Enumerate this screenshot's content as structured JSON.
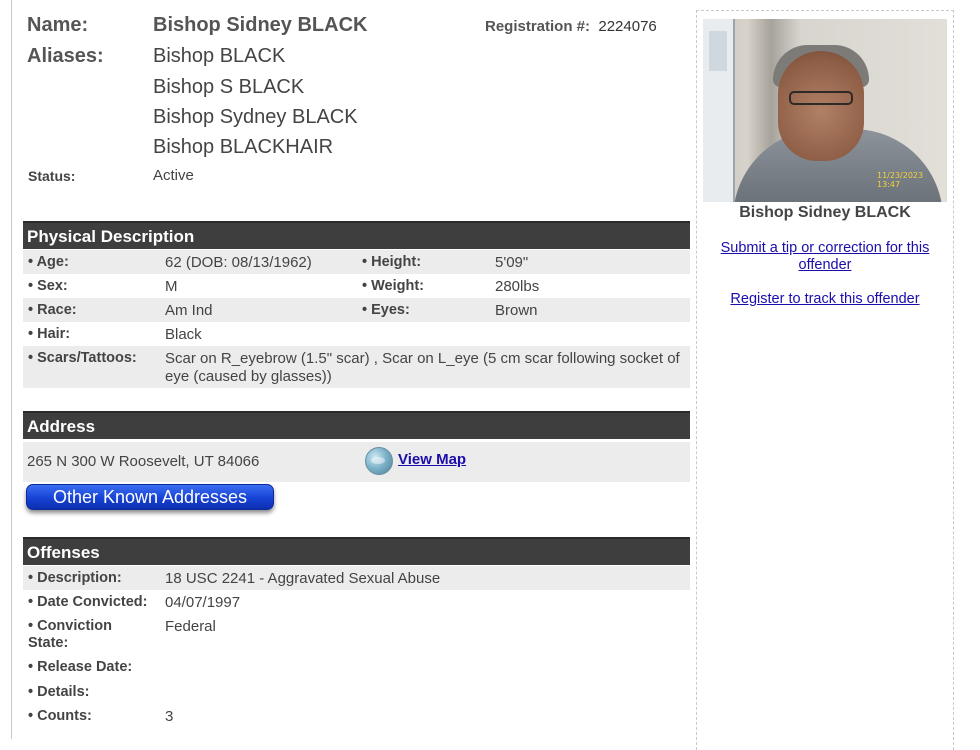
{
  "header": {
    "name_label": "Name:",
    "name_value": "Bishop Sidney BLACK",
    "aliases_label": "Aliases:",
    "aliases": [
      "Bishop BLACK",
      "Bishop S BLACK",
      "Bishop Sydney BLACK",
      "Bishop BLACKHAIR"
    ],
    "registration_label": "Registration #:",
    "registration_value": "2224076",
    "status_label": "Status:",
    "status_value": "Active"
  },
  "physical": {
    "title": "Physical Description",
    "age_label": "• Age:",
    "age_value": "62  (DOB: 08/13/1962)",
    "height_label": "• Height:",
    "height_value": "5'09\"",
    "sex_label": "• Sex:",
    "sex_value": "M",
    "weight_label": "• Weight:",
    "weight_value": "280lbs",
    "race_label": "• Race:",
    "race_value": "Am Ind",
    "eyes_label": "• Eyes:",
    "eyes_value": "Brown",
    "hair_label": "• Hair:",
    "hair_value": "Black",
    "scars_label": "• Scars/Tattoos:",
    "scars_line1": "Scar on R_eyebrow (1.5\" scar) , Scar on L_eye (5 cm scar following socket of",
    "scars_line2": "eye (caused by glasses))"
  },
  "address": {
    "title": "Address",
    "text": "265 N 300 W Roosevelt, UT 84066",
    "map_link": "View Map",
    "map_icon": "globe-icon",
    "other_button": "Other Known Addresses"
  },
  "offenses": {
    "title": "Offenses",
    "description_label": "• Description:",
    "description_value": "18 USC 2241 - Aggravated Sexual Abuse",
    "date_label": "• Date Convicted:",
    "date_value": "04/07/1997",
    "state_label_1": "• Conviction",
    "state_label_2": "State:",
    "state_value": "Federal",
    "release_label": "• Release Date:",
    "details_label": "• Details:",
    "counts_label": "• Counts:",
    "counts_value": "3"
  },
  "sidebar": {
    "photo_caption": "Bishop Sidney BLACK",
    "photo_stamp": "11/23/2023 13:47",
    "tip_link_1": "Submit a tip or correction for this",
    "tip_link_2": "offender",
    "track_link": "Register to track this offender"
  },
  "colors": {
    "section_header_bg": "#3e3e3e",
    "row_shade": "#ececec",
    "link": "#1a0dab",
    "button_blue": "#1642d6"
  }
}
